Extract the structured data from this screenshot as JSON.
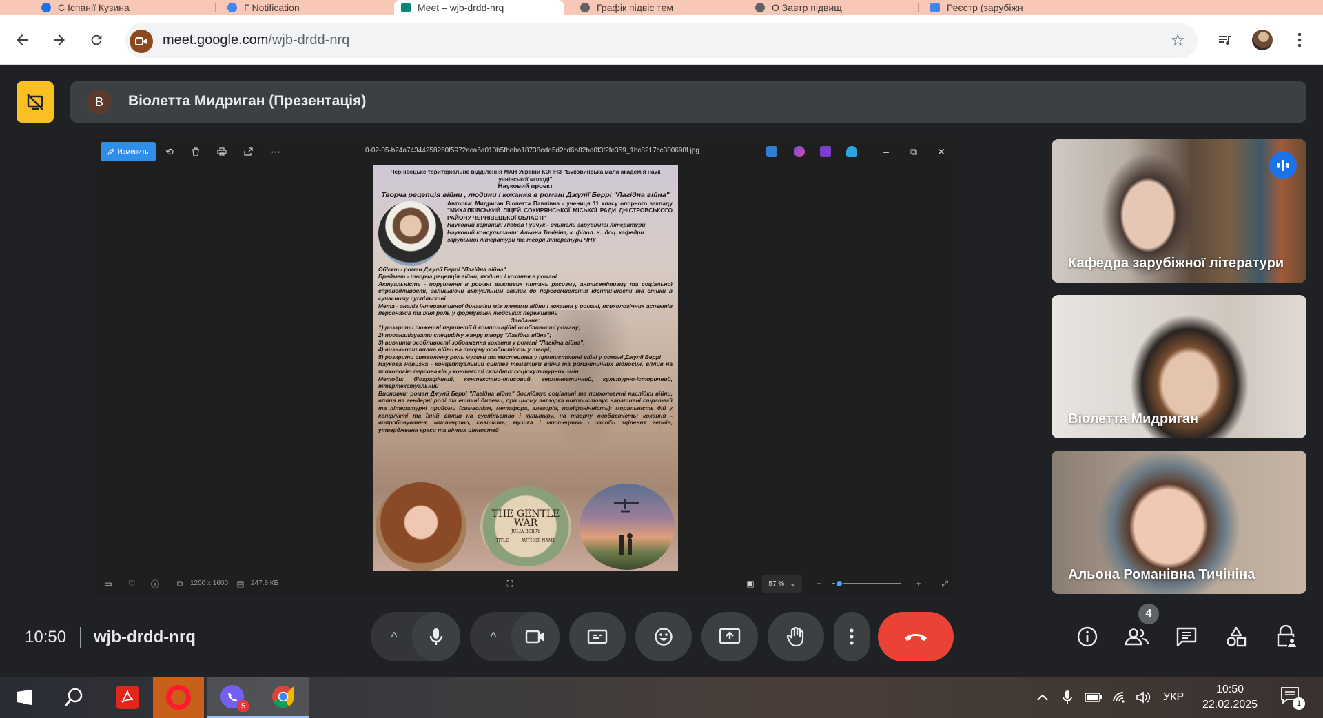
{
  "browser": {
    "tabs": [
      {
        "label": "С Іспанії Кузина",
        "color": "#1a73e8"
      },
      {
        "label": "Г Notification",
        "color": "#4285f4"
      },
      {
        "label": "Meet – wjb-drdd-nrq",
        "color": "#00897b"
      },
      {
        "label": "Графік підвіс тем",
        "color": "#5f6368"
      },
      {
        "label": "О Завтр підвищ",
        "color": "#5f6368"
      },
      {
        "label": "Реєстр (зарубіжн",
        "color": "#4285f4"
      }
    ],
    "url_host": "meet.google.com",
    "url_path": "/wjb-drdd-nrq"
  },
  "meet": {
    "presenter_initial": "B",
    "presenter_label": "Віолетта Мидриган (Презентація)",
    "clock": "10:50",
    "meeting_code": "wjb-drdd-nrq",
    "people_count": "4",
    "participants": [
      {
        "name": "Кафедра зарубіжної літератури",
        "speaking": true
      },
      {
        "name": "Віолетта Мидриган",
        "speaking": false
      },
      {
        "name": "Альона Романівна Тичініна",
        "speaking": false
      }
    ],
    "colors": {
      "accent": "#8ab4f8",
      "end_call": "#ea4335",
      "tile_icon": "#f9bf23"
    }
  },
  "viewer": {
    "edit_label": "Изменить",
    "filename": "0-02-05-b24a74344258250f5972aca5a010b5fbeba18738ede5d2cd6a82bd0f3f2fe359_1bc8217cc300698f.jpg",
    "dimensions": "1200 x 1600",
    "filesize": "247.8 КБ",
    "zoom": "57 %",
    "zoom_fraction": 0.1
  },
  "poster": {
    "org": "Чернівецьке територіальне відділення МАН України КОПНЗ \"Буковинська мала академія наук учнівської молоді\"",
    "kind": "Науковий проект",
    "title": "Творча рецепція війни , людини і кохання в романі Джулії Беррі \"Лагідна війна\"",
    "author": "Авторка: Мидриган Віолетта Павлівна - учениця 11 класу опорного закладу \"МИХАЛКІВСЬКИЙ ЛІЦЕЙ СОКИРЯНСЬКОЇ МІСЬКОЇ РАДИ ДНІСТРОВСЬКОГО РАЙОНУ ЧЕРНІВЕЦЬКОЇ ОБЛАСТІ\"",
    "supervisor": "Науковий керівник: Любов Гуйчук - вчитель зарубіжної літератури",
    "consultant": "Науковий консультант: Альона Тичініна, к. філол. н., доц. кафедри зарубіжної літератури та теорії літератури ЧНУ",
    "object": "Об'єкт - роман Джулії Беррі \"Лагідна війна\"",
    "subject": "Предмет - творча рецепція війни, людини і кохання в романі",
    "relevance": "Актуальність - порушення в романі важливих питань расизму, антисемітизму та соціальної справедливості, залишаючи актуальним заклик до переосмислення ідентичності та етики в сучасному суспільстві",
    "goal": "Мета - аналіз інтерактивної динаміки між темами війни і кохання у романі, психологічних аспектів персонажів та їхня роль у формуванні людських переживань",
    "tasks_head": "Завдання:",
    "tasks": [
      "1) розкрити сюжетні перипетії й композиційні особливості роману;",
      "2) проаналізувати специфіку жанру твору \"Лагідна війна\";",
      "3) вивчити особливості зображення кохання у романі \"Лагідна війна\";",
      "4) визначити вплив війни на творчу особистість у творі;",
      "5) розкрити символічну роль музики та мистецтва у протистоянні війні у романі Джулії Беррі"
    ],
    "novelty": "Наукова новизна - концептуальний синтез тематики війни та романтичних відносин, вплив на психологію персонажів у контексті складних соціокультурних змін",
    "methods": "Методи: біографічний, контекстно-описовий, герменевтичний, культурно-історичний, інтертекстуальний",
    "conclusions": "Висновки: роман Джулії Беррі \"Лагідна війна\" досліджує соціальні та психологічні наслідки війни, вплив на гендерні ролі та етичні дилеми, при цьому авторка використовує наративні стратегії та літературні прийоми (символізм, метафора, алегорія, поліфонічність); моральність дій у конфлікті та їхній вплив на суспільство і культуру, на творчу особистість; кохання - випробовування, мистецтво, святість; музика і мистецтво - засоби зцілення героїв, утвердження краси та вічних цінностей",
    "book_title": "THE GENTLE WAR",
    "book_author": "JULIA BERRY",
    "book_tag_left": "TITLE",
    "book_tag_right": "AUTHOR NAME"
  },
  "taskbar": {
    "viber_badge": "5",
    "language": "УКР",
    "time": "10:50",
    "date": "22.02.2025",
    "notifications": "1"
  }
}
